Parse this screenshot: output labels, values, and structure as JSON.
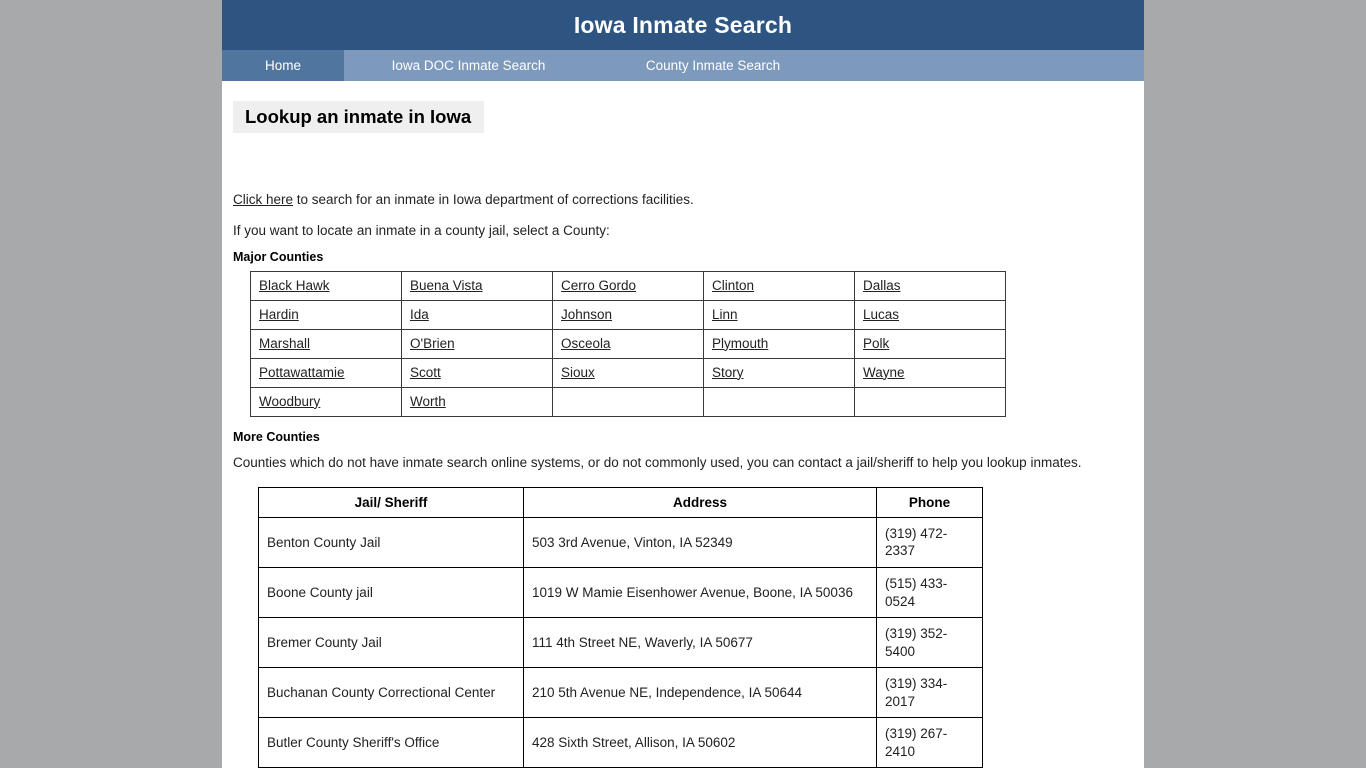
{
  "masthead": {
    "title": "Iowa Inmate Search"
  },
  "nav": {
    "items": [
      {
        "label": "Home",
        "active": true
      },
      {
        "label": "Iowa DOC Inmate Search",
        "active": false
      },
      {
        "label": "County Inmate Search",
        "active": false
      }
    ]
  },
  "page": {
    "title": "Lookup an inmate in Iowa"
  },
  "intro": {
    "link_text": "Click here",
    "link_tail": " to search for an inmate in Iowa department of corrections facilities.",
    "county_prompt": "If you want to locate an inmate in a county jail, select a County:"
  },
  "major_counties": {
    "heading": "Major Counties",
    "rows": [
      [
        "Black Hawk",
        "Buena Vista",
        "Cerro Gordo",
        "Clinton",
        "Dallas"
      ],
      [
        "Hardin",
        "Ida",
        "Johnson",
        "Linn",
        "Lucas"
      ],
      [
        "Marshall",
        "O'Brien",
        "Osceola",
        "Plymouth",
        "Polk"
      ],
      [
        "Pottawattamie",
        "Scott",
        "Sioux",
        "Story",
        "Wayne"
      ],
      [
        "Woodbury",
        "Worth",
        "",
        "",
        ""
      ]
    ]
  },
  "more_counties": {
    "heading": "More Counties",
    "description": "Counties which do not have inmate search online systems, or do not commonly used, you can contact a jail/sheriff to help you lookup inmates."
  },
  "jail_table": {
    "headers": [
      "Jail/ Sheriff",
      "Address",
      "Phone"
    ],
    "rows": [
      {
        "name": "Benton County Jail",
        "address": "503 3rd Avenue, Vinton, IA 52349",
        "phone": "(319) 472-2337"
      },
      {
        "name": "Boone County jail",
        "address": "1019 W Mamie Eisenhower Avenue, Boone, IA 50036",
        "phone": "(515) 433-0524"
      },
      {
        "name": "Bremer County Jail",
        "address": "111 4th Street NE, Waverly, IA 50677",
        "phone": "(319) 352-5400"
      },
      {
        "name": "Buchanan County Correctional Center",
        "address": "210 5th Avenue NE, Independence, IA 50644",
        "phone": "(319) 334-2017"
      },
      {
        "name": "Butler County Sheriff's Office",
        "address": "428 Sixth Street, Allison, IA 50602",
        "phone": "(319) 267-2410"
      }
    ]
  },
  "colors": {
    "masthead_bg": "#2e5582",
    "nav_bg": "#7d99bc",
    "nav_active_bg": "#50759f",
    "page_bg": "#ffffff",
    "outer_bg": "#a8a9ab",
    "title_highlight": "#efefef"
  }
}
